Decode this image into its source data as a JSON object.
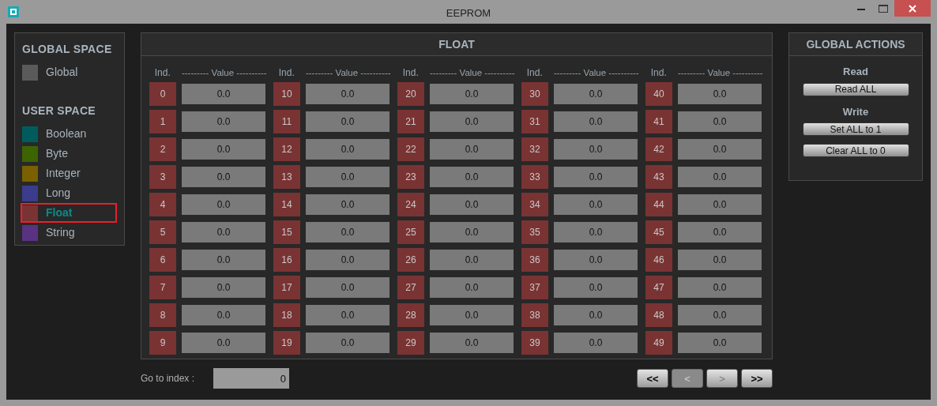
{
  "window": {
    "title": "EEPROM"
  },
  "sidebar": {
    "sections": [
      {
        "title": "GLOBAL SPACE",
        "items": [
          {
            "label": "Global",
            "color": "#5a5a5a",
            "selected": false
          }
        ]
      },
      {
        "title": "USER SPACE",
        "items": [
          {
            "label": "Boolean",
            "color": "#005c5c",
            "selected": false
          },
          {
            "label": "Byte",
            "color": "#3c6400",
            "selected": false
          },
          {
            "label": "Integer",
            "color": "#7a6000",
            "selected": false
          },
          {
            "label": "Long",
            "color": "#3c3c8c",
            "selected": false
          },
          {
            "label": "Float",
            "color": "#7a3333",
            "selected": true
          },
          {
            "label": "String",
            "color": "#5a3282",
            "selected": false
          }
        ]
      }
    ]
  },
  "table": {
    "title": "FLOAT",
    "groups": [
      {
        "index_header": "Ind.",
        "value_header": "--------- Value ----------",
        "cells": [
          {
            "index": "0",
            "value": "0.0"
          },
          {
            "index": "1",
            "value": "0.0"
          },
          {
            "index": "2",
            "value": "0.0"
          },
          {
            "index": "3",
            "value": "0.0"
          },
          {
            "index": "4",
            "value": "0.0"
          },
          {
            "index": "5",
            "value": "0.0"
          },
          {
            "index": "6",
            "value": "0.0"
          },
          {
            "index": "7",
            "value": "0.0"
          },
          {
            "index": "8",
            "value": "0.0"
          },
          {
            "index": "9",
            "value": "0.0"
          }
        ]
      },
      {
        "index_header": "Ind.",
        "value_header": "--------- Value ----------",
        "cells": [
          {
            "index": "10",
            "value": "0.0"
          },
          {
            "index": "11",
            "value": "0.0"
          },
          {
            "index": "12",
            "value": "0.0"
          },
          {
            "index": "13",
            "value": "0.0"
          },
          {
            "index": "14",
            "value": "0.0"
          },
          {
            "index": "15",
            "value": "0.0"
          },
          {
            "index": "16",
            "value": "0.0"
          },
          {
            "index": "17",
            "value": "0.0"
          },
          {
            "index": "18",
            "value": "0.0"
          },
          {
            "index": "19",
            "value": "0.0"
          }
        ]
      },
      {
        "index_header": "Ind.",
        "value_header": "--------- Value ----------",
        "cells": [
          {
            "index": "20",
            "value": "0.0"
          },
          {
            "index": "21",
            "value": "0.0"
          },
          {
            "index": "22",
            "value": "0.0"
          },
          {
            "index": "23",
            "value": "0.0"
          },
          {
            "index": "24",
            "value": "0.0"
          },
          {
            "index": "25",
            "value": "0.0"
          },
          {
            "index": "26",
            "value": "0.0"
          },
          {
            "index": "27",
            "value": "0.0"
          },
          {
            "index": "28",
            "value": "0.0"
          },
          {
            "index": "29",
            "value": "0.0"
          }
        ]
      },
      {
        "index_header": "Ind.",
        "value_header": "--------- Value ----------",
        "cells": [
          {
            "index": "30",
            "value": "0.0"
          },
          {
            "index": "31",
            "value": "0.0"
          },
          {
            "index": "32",
            "value": "0.0"
          },
          {
            "index": "33",
            "value": "0.0"
          },
          {
            "index": "34",
            "value": "0.0"
          },
          {
            "index": "35",
            "value": "0.0"
          },
          {
            "index": "36",
            "value": "0.0"
          },
          {
            "index": "37",
            "value": "0.0"
          },
          {
            "index": "38",
            "value": "0.0"
          },
          {
            "index": "39",
            "value": "0.0"
          }
        ]
      },
      {
        "index_header": "Ind.",
        "value_header": "--------- Value ----------",
        "cells": [
          {
            "index": "40",
            "value": "0.0"
          },
          {
            "index": "41",
            "value": "0.0"
          },
          {
            "index": "42",
            "value": "0.0"
          },
          {
            "index": "43",
            "value": "0.0"
          },
          {
            "index": "44",
            "value": "0.0"
          },
          {
            "index": "45",
            "value": "0.0"
          },
          {
            "index": "46",
            "value": "0.0"
          },
          {
            "index": "47",
            "value": "0.0"
          },
          {
            "index": "48",
            "value": "0.0"
          },
          {
            "index": "49",
            "value": "0.0"
          }
        ]
      }
    ]
  },
  "actions": {
    "title": "GLOBAL ACTIONS",
    "sections": [
      {
        "title": "Read",
        "buttons": [
          "Read ALL"
        ]
      },
      {
        "title": "Write",
        "buttons": [
          "Set ALL to 1",
          "Clear ALL to 0"
        ]
      }
    ]
  },
  "footer": {
    "goto_label": "Go to index :",
    "goto_value": "0",
    "nav": [
      {
        "label": "<<",
        "disabled": false,
        "pressed": false
      },
      {
        "label": "<",
        "disabled": true,
        "pressed": true
      },
      {
        "label": ">",
        "disabled": true,
        "pressed": false
      },
      {
        "label": ">>",
        "disabled": false,
        "pressed": false
      }
    ]
  }
}
